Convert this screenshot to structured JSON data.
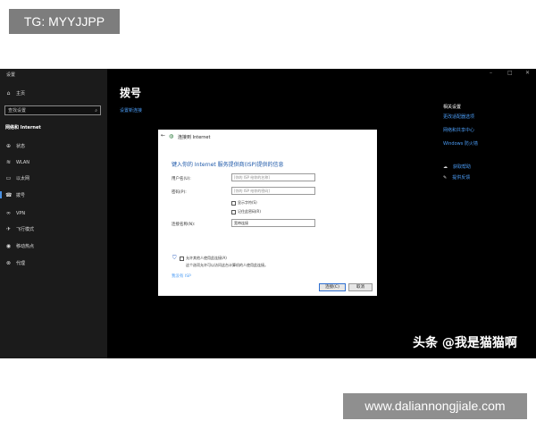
{
  "overlay_tag": "TG: MYYJJPP",
  "footer_site": "www.daliannongjiale.com",
  "window": {
    "title": "设置",
    "controls": [
      "–",
      "□",
      "✕"
    ]
  },
  "sidebar": {
    "home": "主页",
    "search_placeholder": "查找设置",
    "section": "网络和 Internet",
    "items": [
      {
        "label": "状态",
        "icon": "globe-icon"
      },
      {
        "label": "WLAN",
        "icon": "wifi-icon"
      },
      {
        "label": "以太网",
        "icon": "ethernet-icon"
      },
      {
        "label": "拨号",
        "icon": "dialup-icon"
      },
      {
        "label": "VPN",
        "icon": "vpn-icon"
      },
      {
        "label": "飞行模式",
        "icon": "airplane-icon"
      },
      {
        "label": "移动热点",
        "icon": "hotspot-icon"
      },
      {
        "label": "代理",
        "icon": "proxy-icon"
      }
    ]
  },
  "main": {
    "title": "拨号",
    "setup_link": "设置新连接"
  },
  "related": {
    "heading": "相关设置",
    "links": [
      "更改适配器选项",
      "网络和共享中心",
      "Windows 防火墙"
    ],
    "help": "获取帮助",
    "feedback": "提供反馈"
  },
  "dialog": {
    "title": "连接到 Internet",
    "heading": "键入你的 Internet 服务提供商(ISP)提供的信息",
    "username_label": "用户名(U):",
    "username_placeholder": "[你的 ISP 给你的名称]",
    "password_label": "密码(P):",
    "password_placeholder": "[你的 ISP 给你的密码]",
    "show_chars": "显示字符(S)",
    "remember_password": "记住此密码(R)",
    "connection_name_label": "连接名称(N):",
    "connection_name_value": "宽带连接",
    "allow_others": "允许其他人使用此连接(A)",
    "allow_others_desc": "这个选项允许可以访问这台计算机的人使用此连接。",
    "no_isp_link": "我没有 ISP",
    "connect_button": "连接(C)",
    "cancel_button": "取消"
  },
  "watermark": "头条 @我是猫猫啊",
  "colors": {
    "link": "#4b9cf5",
    "heading": "#1c57a8",
    "sidebar_bg": "#1b1b1b",
    "screen_bg": "#000000"
  }
}
